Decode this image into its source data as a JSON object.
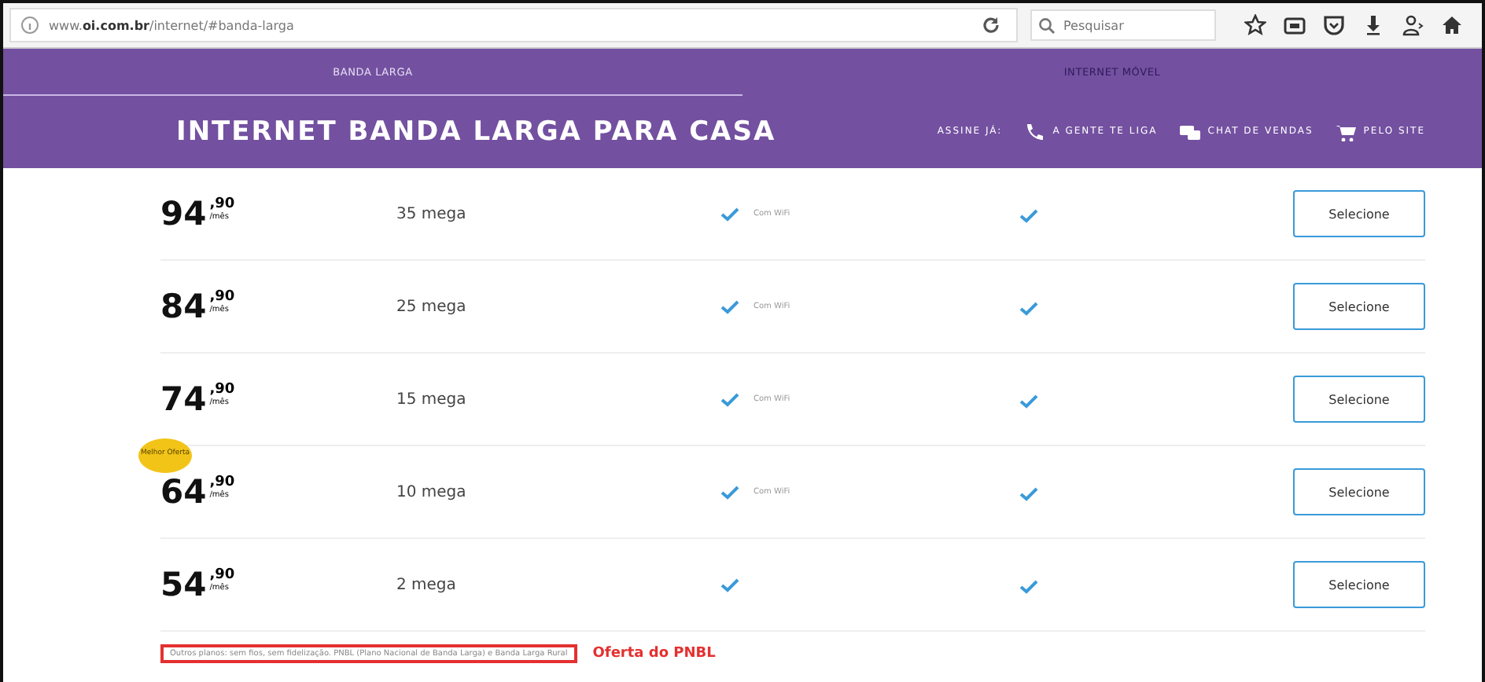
{
  "browser": {
    "url": "www.**oi.com.br**/internet/#banda-larga",
    "search": {
      "placeholder": "Pesquisar"
    }
  },
  "tabs": [
    {
      "label": "BANDA LARGA",
      "selected": true
    },
    {
      "label": "INTERNET MÓVEL",
      "selected": false
    }
  ],
  "header": {
    "title": "INTERNET BANDA LARGA PARA CASA",
    "contact_label": "ASSINE JÁ:",
    "contacts": [
      {
        "kind": "phone",
        "label": "A GENTE TE LIGA"
      },
      {
        "kind": "chat",
        "label": "CHAT DE VENDAS"
      },
      {
        "kind": "cart",
        "label": "PELO SITE"
      }
    ]
  },
  "plans": [
    {
      "price": "94",
      "cents": ",90",
      "period": "/mês",
      "speed": "35 mega",
      "wifi": {
        "checked": true,
        "label": "Com WiFi"
      },
      "column_4": {
        "checked": true
      },
      "button": "Selecione"
    },
    {
      "price": "84",
      "cents": ",90",
      "period": "/mês",
      "speed": "25 mega",
      "wifi": {
        "checked": true,
        "label": "Com WiFi"
      },
      "column_4": {
        "checked": true
      },
      "button": "Selecione"
    },
    {
      "price": "74",
      "cents": ",90",
      "period": "/mês",
      "speed": "15 mega",
      "wifi": {
        "checked": true,
        "label": "Com WiFi"
      },
      "column_4": {
        "checked": true
      },
      "button": "Selecione"
    },
    {
      "price": "64",
      "cents": ",90",
      "period": "/mês",
      "speed": "10 mega",
      "badge": "Melhor Oferta",
      "wifi": {
        "checked": true,
        "label": "Com WiFi"
      },
      "column_4": {
        "checked": true
      },
      "button": "Selecione"
    },
    {
      "price": "54",
      "cents": ",90",
      "period": "/mês",
      "speed": "2 mega",
      "wifi": {
        "checked": true
      },
      "column_4": {
        "checked": true
      },
      "button": "Selecione"
    }
  ],
  "footnote": "Outros planos: sem fios, sem fidelização. PNBL (Plano Nacional de Banda Larga) e Banda Larga Rural",
  "annotation": "Oferta do PNBL"
}
